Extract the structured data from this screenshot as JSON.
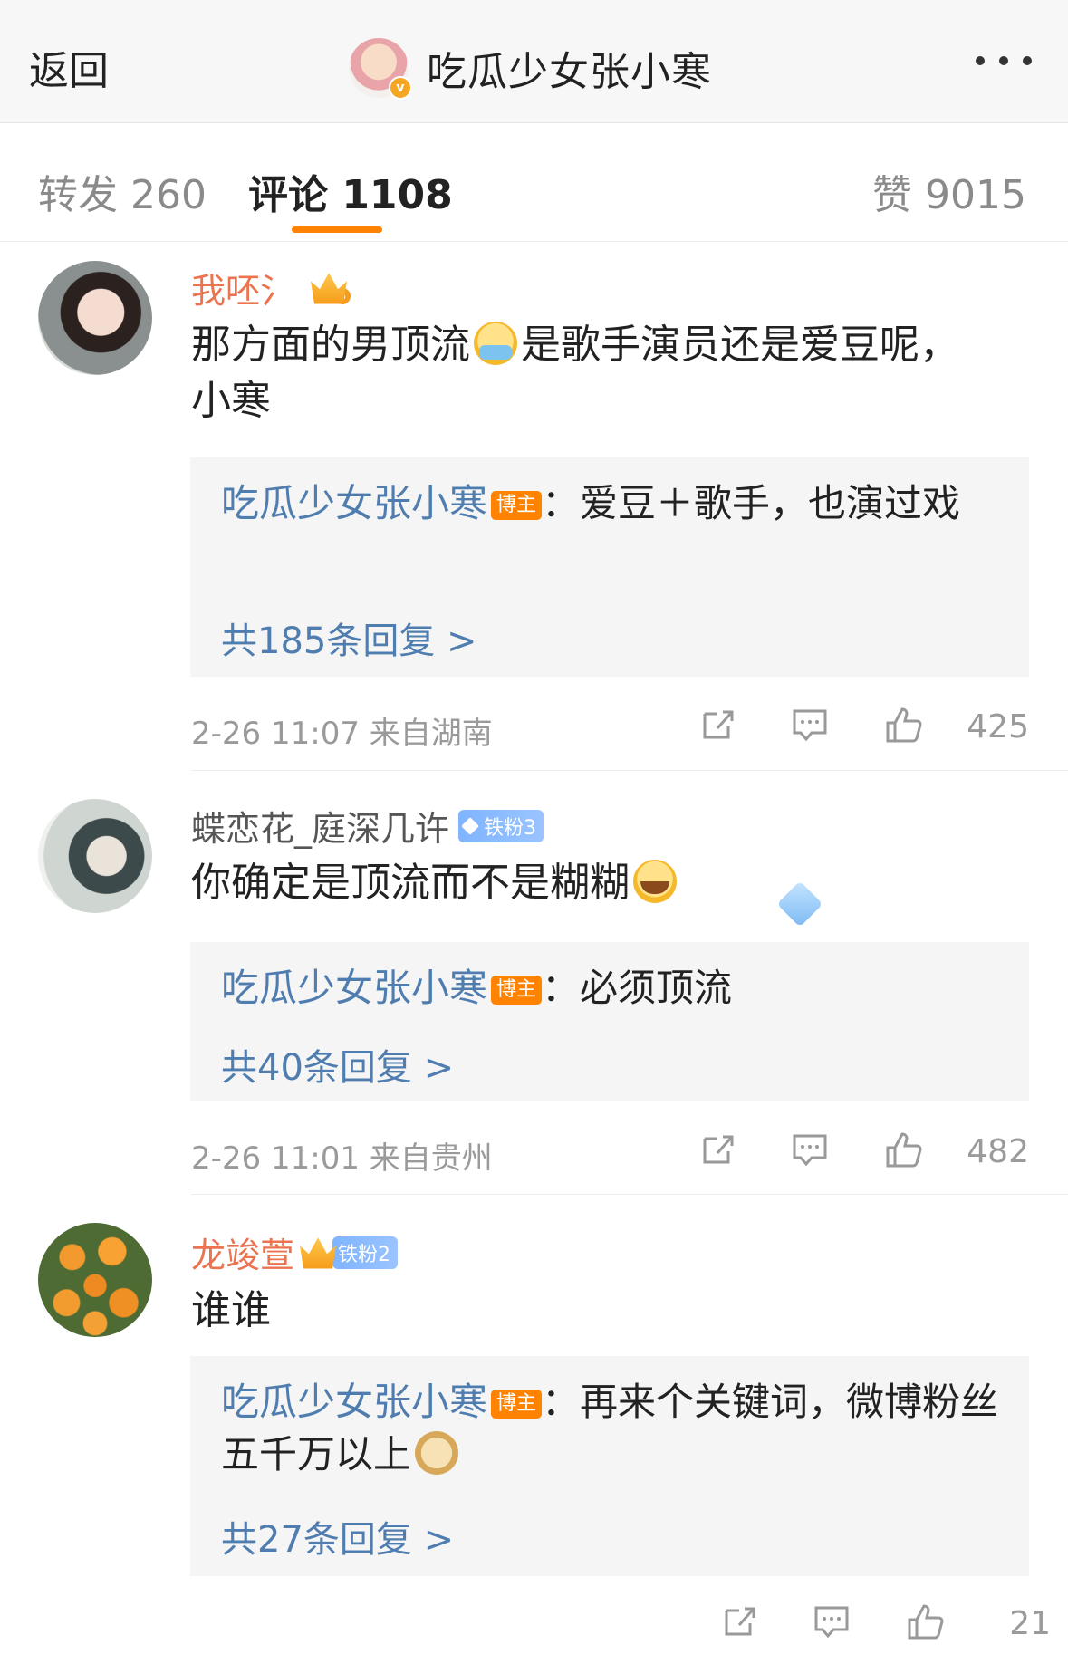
{
  "nav": {
    "back_label": "返回",
    "title": "吃瓜少女张小寒"
  },
  "tabs": {
    "forward": "转发 260",
    "comments": "评论 1108",
    "likes": "赞 9015"
  },
  "colors": {
    "accent": "#ff8200",
    "link_blue": "#507daf",
    "username_orange": "#eb7350"
  },
  "comments": [
    {
      "username": "我呸氵",
      "text_before_emoji": "那方面的男顶流",
      "emoji": "mask-face-emoji",
      "text_after_emoji": "是歌手演员还是爱豆呢，小寒",
      "reply": {
        "author": "吃瓜少女张小寒",
        "tag": "博主",
        "text": "：爱豆＋歌手，也演过戏",
        "count_label": "共185条回复 >"
      },
      "time": "2-26 11:07",
      "location": "来自湖南",
      "likes": "425"
    },
    {
      "username": "蝶恋花_庭深几许",
      "fan_badge": "铁粉3",
      "text": "你确定是顶流而不是糊糊",
      "emoji": "crying-face-emoji",
      "reply": {
        "author": "吃瓜少女张小寒",
        "tag": "博主",
        "text": "：必须顶流",
        "count_label": "共40条回复 >"
      },
      "time": "2-26 11:01",
      "location": "来自贵州",
      "likes": "482"
    },
    {
      "username": "龙竣萱",
      "fan_badge": "铁粉2",
      "text": "谁谁",
      "reply": {
        "author": "吃瓜少女张小寒",
        "tag": "博主",
        "text": "：再来个关键词，微博粉丝五千万以上",
        "emoji": "doge-emoji",
        "count_label": "共27条回复 >"
      },
      "likes": "21"
    }
  ]
}
